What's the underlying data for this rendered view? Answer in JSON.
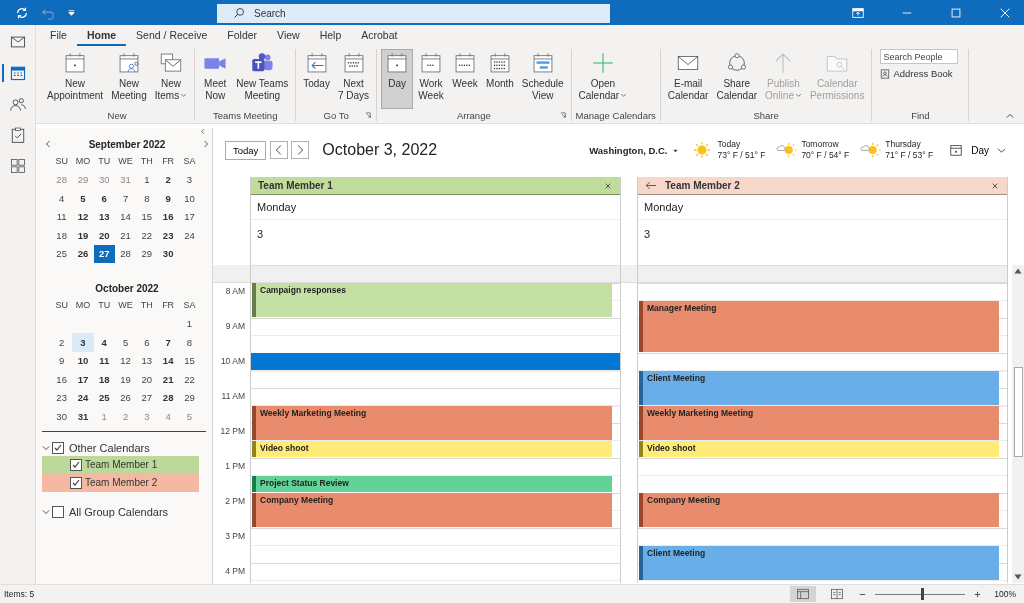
{
  "search": {
    "placeholder": "Search"
  },
  "nav_rail": [
    {
      "kind": "mail",
      "selected": false
    },
    {
      "kind": "calendar",
      "selected": true
    },
    {
      "kind": "people",
      "selected": false
    },
    {
      "kind": "tasks",
      "selected": false
    },
    {
      "kind": "apps",
      "selected": false
    }
  ],
  "ribbon_tabs": [
    {
      "label": "File",
      "selected": false
    },
    {
      "label": "Home",
      "selected": true
    },
    {
      "label": "Send / Receive",
      "selected": false
    },
    {
      "label": "Folder",
      "selected": false
    },
    {
      "label": "View",
      "selected": false
    },
    {
      "label": "Help",
      "selected": false
    },
    {
      "label": "Acrobat",
      "selected": false
    }
  ],
  "ribbon_groups": [
    {
      "kind": "buttons",
      "label": "New",
      "launcher": false,
      "buttons": [
        {
          "kind": "appointment",
          "label": "New\nAppointment",
          "dropdown": false,
          "disabled": false,
          "selected": false
        },
        {
          "kind": "meeting",
          "label": "New\nMeeting",
          "dropdown": false,
          "disabled": false,
          "selected": false
        },
        {
          "kind": "items",
          "label": "New\nItems",
          "dropdown": true,
          "disabled": false,
          "selected": false
        }
      ]
    },
    {
      "kind": "buttons",
      "label": "Teams Meeting",
      "launcher": false,
      "buttons": [
        {
          "kind": "video",
          "label": "Meet\nNow",
          "dropdown": false,
          "disabled": false,
          "selected": false
        },
        {
          "kind": "teams",
          "label": "New Teams\nMeeting",
          "dropdown": false,
          "disabled": false,
          "selected": false
        }
      ]
    },
    {
      "kind": "buttons",
      "label": "Go To",
      "launcher": true,
      "buttons": [
        {
          "kind": "today",
          "label": "Today",
          "dropdown": false,
          "disabled": false,
          "selected": false
        },
        {
          "kind": "next7",
          "label": "Next\n7 Days",
          "dropdown": false,
          "disabled": false,
          "selected": false
        }
      ]
    },
    {
      "kind": "buttons",
      "label": "Arrange",
      "launcher": true,
      "buttons": [
        {
          "kind": "day",
          "label": "Day",
          "dropdown": false,
          "disabled": false,
          "selected": true
        },
        {
          "kind": "workweek",
          "label": "Work\nWeek",
          "dropdown": false,
          "disabled": false,
          "selected": false
        },
        {
          "kind": "week",
          "label": "Week",
          "dropdown": false,
          "disabled": false,
          "selected": false
        },
        {
          "kind": "month",
          "label": "Month",
          "dropdown": false,
          "disabled": false,
          "selected": false
        },
        {
          "kind": "schedule",
          "label": "Schedule\nView",
          "dropdown": false,
          "disabled": false,
          "selected": false
        }
      ]
    },
    {
      "kind": "buttons",
      "label": "Manage Calendars",
      "launcher": false,
      "buttons": [
        {
          "kind": "open",
          "label": "Open\nCalendar",
          "dropdown": true,
          "disabled": false,
          "selected": false
        }
      ]
    },
    {
      "kind": "buttons",
      "label": "Share",
      "launcher": false,
      "buttons": [
        {
          "kind": "email",
          "label": "E-mail\nCalendar",
          "dropdown": false,
          "disabled": false,
          "selected": false
        },
        {
          "kind": "share",
          "label": "Share\nCalendar",
          "dropdown": false,
          "disabled": false,
          "selected": false
        },
        {
          "kind": "publish",
          "label": "Publish\nOnline",
          "dropdown": true,
          "disabled": true,
          "selected": false
        },
        {
          "kind": "permissions",
          "label": "Calendar\nPermissions",
          "dropdown": false,
          "disabled": true,
          "selected": false
        }
      ]
    },
    {
      "kind": "find",
      "label": "Find",
      "launcher": false,
      "field": {
        "placeholder": "Search People"
      },
      "link": "Address Book"
    }
  ],
  "months": [
    {
      "title": "September 2022",
      "weekdays": [
        "SU",
        "MO",
        "TU",
        "WE",
        "TH",
        "FR",
        "SA"
      ],
      "weeks": [
        [
          {
            "n": "28",
            "kind": "other",
            "selected": false,
            "shown": false
          },
          {
            "n": "29",
            "kind": "other",
            "selected": false,
            "shown": false
          },
          {
            "n": "30",
            "kind": "other",
            "selected": false,
            "shown": false
          },
          {
            "n": "31",
            "kind": "other",
            "selected": false,
            "shown": false
          },
          {
            "n": "1",
            "kind": "free",
            "selected": false,
            "shown": false
          },
          {
            "n": "2",
            "kind": "busy",
            "selected": false,
            "shown": false
          },
          {
            "n": "3",
            "kind": "free",
            "selected": false,
            "shown": false
          }
        ],
        [
          {
            "n": "4",
            "kind": "free",
            "selected": false,
            "shown": false
          },
          {
            "n": "5",
            "kind": "busy",
            "selected": false,
            "shown": false
          },
          {
            "n": "6",
            "kind": "busy",
            "selected": false,
            "shown": false
          },
          {
            "n": "7",
            "kind": "free",
            "selected": false,
            "shown": false
          },
          {
            "n": "8",
            "kind": "free",
            "selected": false,
            "shown": false
          },
          {
            "n": "9",
            "kind": "busy",
            "selected": false,
            "shown": false
          },
          {
            "n": "10",
            "kind": "free",
            "selected": false,
            "shown": false
          }
        ],
        [
          {
            "n": "11",
            "kind": "free",
            "selected": false,
            "shown": false
          },
          {
            "n": "12",
            "kind": "busy",
            "selected": false,
            "shown": false
          },
          {
            "n": "13",
            "kind": "busy",
            "selected": false,
            "shown": false
          },
          {
            "n": "14",
            "kind": "free",
            "selected": false,
            "shown": false
          },
          {
            "n": "15",
            "kind": "free",
            "selected": false,
            "shown": false
          },
          {
            "n": "16",
            "kind": "busy",
            "selected": false,
            "shown": false
          },
          {
            "n": "17",
            "kind": "free",
            "selected": false,
            "shown": false
          }
        ],
        [
          {
            "n": "18",
            "kind": "free",
            "selected": false,
            "shown": false
          },
          {
            "n": "19",
            "kind": "busy",
            "selected": false,
            "shown": false
          },
          {
            "n": "20",
            "kind": "busy",
            "selected": false,
            "shown": false
          },
          {
            "n": "21",
            "kind": "free",
            "selected": false,
            "shown": false
          },
          {
            "n": "22",
            "kind": "free",
            "selected": false,
            "shown": false
          },
          {
            "n": "23",
            "kind": "busy",
            "selected": false,
            "shown": false
          },
          {
            "n": "24",
            "kind": "free",
            "selected": false,
            "shown": false
          }
        ],
        [
          {
            "n": "25",
            "kind": "free",
            "selected": false,
            "shown": false
          },
          {
            "n": "26",
            "kind": "busy",
            "selected": false,
            "shown": false
          },
          {
            "n": "27",
            "kind": "busy",
            "selected": true,
            "shown": false
          },
          {
            "n": "28",
            "kind": "free",
            "selected": false,
            "shown": false
          },
          {
            "n": "29",
            "kind": "free",
            "selected": false,
            "shown": false
          },
          {
            "n": "30",
            "kind": "busy",
            "selected": false,
            "shown": false
          }
        ]
      ]
    },
    {
      "title": "October 2022",
      "weekdays": [
        "SU",
        "MO",
        "TU",
        "WE",
        "TH",
        "FR",
        "SA"
      ],
      "weeks": [
        [
          {
            "n": "1",
            "kind": "free",
            "selected": false,
            "shown": false
          }
        ],
        [
          {
            "n": "2",
            "kind": "free",
            "selected": false,
            "shown": false
          },
          {
            "n": "3",
            "kind": "busy",
            "selected": false,
            "shown": true
          },
          {
            "n": "4",
            "kind": "busy",
            "selected": false,
            "shown": false
          },
          {
            "n": "5",
            "kind": "free",
            "selected": false,
            "shown": false
          },
          {
            "n": "6",
            "kind": "free",
            "selected": false,
            "shown": false
          },
          {
            "n": "7",
            "kind": "busy",
            "selected": false,
            "shown": false
          },
          {
            "n": "8",
            "kind": "free",
            "selected": false,
            "shown": false
          }
        ],
        [
          {
            "n": "9",
            "kind": "free",
            "selected": false,
            "shown": false
          },
          {
            "n": "10",
            "kind": "busy",
            "selected": false,
            "shown": false
          },
          {
            "n": "11",
            "kind": "busy",
            "selected": false,
            "shown": false
          },
          {
            "n": "12",
            "kind": "free",
            "selected": false,
            "shown": false
          },
          {
            "n": "13",
            "kind": "free",
            "selected": false,
            "shown": false
          },
          {
            "n": "14",
            "kind": "busy",
            "selected": false,
            "shown": false
          },
          {
            "n": "15",
            "kind": "free",
            "selected": false,
            "shown": false
          }
        ],
        [
          {
            "n": "16",
            "kind": "free",
            "selected": false,
            "shown": false
          },
          {
            "n": "17",
            "kind": "busy",
            "selected": false,
            "shown": false
          },
          {
            "n": "18",
            "kind": "busy",
            "selected": false,
            "shown": false
          },
          {
            "n": "19",
            "kind": "free",
            "selected": false,
            "shown": false
          },
          {
            "n": "20",
            "kind": "free",
            "selected": false,
            "shown": false
          },
          {
            "n": "21",
            "kind": "busy",
            "selected": false,
            "shown": false
          },
          {
            "n": "22",
            "kind": "free",
            "selected": false,
            "shown": false
          }
        ],
        [
          {
            "n": "23",
            "kind": "free",
            "selected": false,
            "shown": false
          },
          {
            "n": "24",
            "kind": "busy",
            "selected": false,
            "shown": false
          },
          {
            "n": "25",
            "kind": "busy",
            "selected": false,
            "shown": false
          },
          {
            "n": "26",
            "kind": "free",
            "selected": false,
            "shown": false
          },
          {
            "n": "27",
            "kind": "free",
            "selected": false,
            "shown": false
          },
          {
            "n": "28",
            "kind": "busy",
            "selected": false,
            "shown": false
          },
          {
            "n": "29",
            "kind": "free",
            "selected": false,
            "shown": false
          }
        ],
        [
          {
            "n": "30",
            "kind": "free",
            "selected": false,
            "shown": false
          },
          {
            "n": "31",
            "kind": "busy",
            "selected": false,
            "shown": false
          },
          {
            "n": "1",
            "kind": "other",
            "selected": false,
            "shown": false
          },
          {
            "n": "2",
            "kind": "other",
            "selected": false,
            "shown": false
          },
          {
            "n": "3",
            "kind": "other",
            "selected": false,
            "shown": false
          },
          {
            "n": "4",
            "kind": "other",
            "selected": false,
            "shown": false
          },
          {
            "n": "5",
            "kind": "other",
            "selected": false,
            "shown": false
          }
        ]
      ]
    }
  ],
  "calendar_groups": [
    {
      "label": "Other Calendars",
      "expanded": true,
      "checked": true,
      "calendars": [
        {
          "label": "Team Member 1",
          "checked": true,
          "color": "#bcd99a"
        },
        {
          "label": "Team Member 2",
          "checked": true,
          "color": "#f5b9a3"
        }
      ]
    },
    {
      "label": "All Group Calendars",
      "expanded": true,
      "checked": false
    }
  ],
  "calendar_nav": {
    "today": "Today",
    "title": "October 3, 2022"
  },
  "weather": {
    "location": "Washington, D.C.",
    "days": [
      {
        "label": "Today",
        "temps": "73° F / 51° F",
        "kind": "sunny"
      },
      {
        "label": "Tomorrow",
        "temps": "70° F / 54° F",
        "kind": "partly"
      },
      {
        "label": "Thursday",
        "temps": "71° F / 53° F",
        "kind": "partly"
      }
    ]
  },
  "view_switch": {
    "label": "Day"
  },
  "time_labels": [
    "8 AM",
    "9 AM",
    "10 AM",
    "11 AM",
    "12 PM",
    "1 PM",
    "2 PM",
    "3 PM",
    "4 PM"
  ],
  "columns": [
    {
      "name": "Team Member 1",
      "color": "#bfdc9b",
      "back_arrow": false,
      "weekday": "Monday",
      "date": "3",
      "slots": [
        {
          "kind": "start",
          "title": "Campaign responses",
          "color": "#c5e0a5"
        },
        {
          "kind": "cont"
        },
        {
          "kind": "free"
        },
        {
          "kind": "free"
        },
        {
          "kind": "selected"
        },
        {
          "kind": "free"
        },
        {
          "kind": "free"
        },
        {
          "kind": "start",
          "title": "Weekly Marketing Meeting",
          "color": "#e98c6d"
        },
        {
          "kind": "cont"
        },
        {
          "kind": "start",
          "title": "Video shoot",
          "color": "#ffeb78"
        },
        {
          "kind": "free"
        },
        {
          "kind": "start",
          "title": "Project Status Review",
          "color": "#62d296"
        },
        {
          "kind": "start",
          "title": "Company Meeting",
          "color": "#e98c6d"
        },
        {
          "kind": "cont"
        },
        {
          "kind": "free"
        },
        {
          "kind": "free"
        },
        {
          "kind": "free"
        }
      ]
    },
    {
      "name": "Team Member 2",
      "color": "#f8d7cb",
      "back_arrow": true,
      "weekday": "Monday",
      "date": "3",
      "slots": [
        {
          "kind": "free"
        },
        {
          "kind": "start",
          "title": "Manager Meeting",
          "color": "#e98c6d"
        },
        {
          "kind": "cont"
        },
        {
          "kind": "cont"
        },
        {
          "kind": "free"
        },
        {
          "kind": "start",
          "title": "Client Meeting",
          "color": "#69aee9"
        },
        {
          "kind": "cont"
        },
        {
          "kind": "start",
          "title": "Weekly Marketing Meeting",
          "color": "#e98c6d"
        },
        {
          "kind": "cont"
        },
        {
          "kind": "start",
          "title": "Video shoot",
          "color": "#ffeb78"
        },
        {
          "kind": "free"
        },
        {
          "kind": "free"
        },
        {
          "kind": "start",
          "title": "Company Meeting",
          "color": "#e98c6d"
        },
        {
          "kind": "cont"
        },
        {
          "kind": "free"
        },
        {
          "kind": "start",
          "title": "Client Meeting",
          "color": "#69aee9"
        },
        {
          "kind": "cont"
        }
      ]
    }
  ],
  "status_bar": {
    "items": "Items: 5",
    "views": [
      {
        "kind": "normal",
        "selected": true
      },
      {
        "kind": "reading",
        "selected": false
      }
    ],
    "zoom": {
      "level": 0.52,
      "reading": "100%"
    }
  }
}
